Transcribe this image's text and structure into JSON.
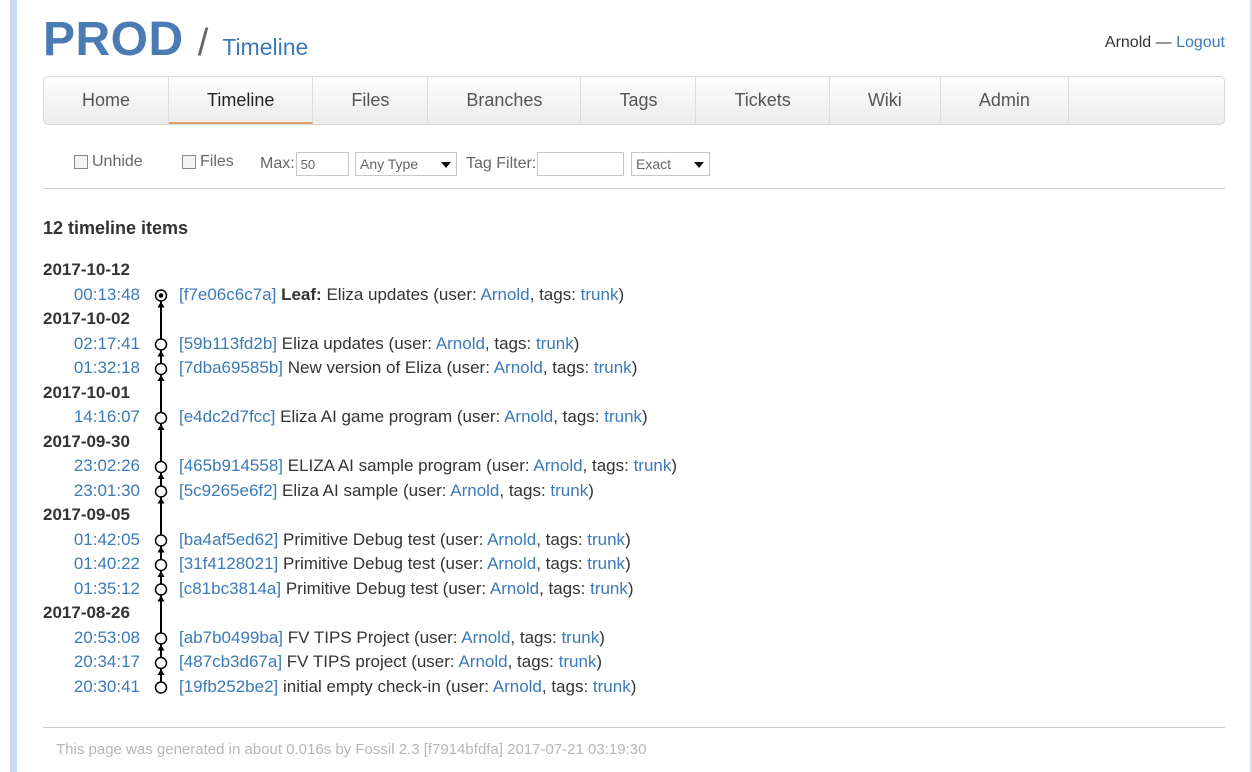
{
  "header": {
    "project": "PROD",
    "separator": "/",
    "page": "Timeline",
    "user": "Arnold",
    "dash": "—",
    "logout": "Logout"
  },
  "menu": {
    "items": [
      "Home",
      "Timeline",
      "Files",
      "Branches",
      "Tags",
      "Tickets",
      "Wiki",
      "Admin"
    ],
    "active": "Timeline"
  },
  "submenu": {
    "unhide_label": "Unhide",
    "files_label": "Files",
    "max_label": "Max:",
    "max_value": "50",
    "type_selected": "Any Type",
    "tag_filter_label": "Tag Filter:",
    "tag_filter_value": "",
    "match_selected": "Exact"
  },
  "timeline": {
    "count_text": "12 timeline items",
    "days": [
      {
        "date": "2017-10-12",
        "entries": [
          {
            "time": "00:13:48",
            "hash": "[f7e06c6c7a]",
            "prefix": "Leaf:",
            "comment": "Eliza updates",
            "user": "Arnold",
            "tag": "trunk",
            "leaf": true
          }
        ]
      },
      {
        "date": "2017-10-02",
        "entries": [
          {
            "time": "02:17:41",
            "hash": "[59b113fd2b]",
            "comment": "Eliza updates",
            "user": "Arnold",
            "tag": "trunk"
          },
          {
            "time": "01:32:18",
            "hash": "[7dba69585b]",
            "comment": "New version of Eliza",
            "user": "Arnold",
            "tag": "trunk"
          }
        ]
      },
      {
        "date": "2017-10-01",
        "entries": [
          {
            "time": "14:16:07",
            "hash": "[e4dc2d7fcc]",
            "comment": "Eliza AI game program",
            "user": "Arnold",
            "tag": "trunk"
          }
        ]
      },
      {
        "date": "2017-09-30",
        "entries": [
          {
            "time": "23:02:26",
            "hash": "[465b914558]",
            "comment": "ELIZA AI sample program",
            "user": "Arnold",
            "tag": "trunk"
          },
          {
            "time": "23:01:30",
            "hash": "[5c9265e6f2]",
            "comment": "Eliza AI sample",
            "user": "Arnold",
            "tag": "trunk"
          }
        ]
      },
      {
        "date": "2017-09-05",
        "entries": [
          {
            "time": "01:42:05",
            "hash": "[ba4af5ed62]",
            "comment": "Primitive Debug test",
            "user": "Arnold",
            "tag": "trunk"
          },
          {
            "time": "01:40:22",
            "hash": "[31f4128021]",
            "comment": "Primitive Debug test",
            "user": "Arnold",
            "tag": "trunk"
          },
          {
            "time": "01:35:12",
            "hash": "[c81bc3814a]",
            "comment": "Primitive Debug test",
            "user": "Arnold",
            "tag": "trunk"
          }
        ]
      },
      {
        "date": "2017-08-26",
        "entries": [
          {
            "time": "20:53:08",
            "hash": "[ab7b0499ba]",
            "comment": "FV TIPS Project",
            "user": "Arnold",
            "tag": "trunk"
          },
          {
            "time": "20:34:17",
            "hash": "[487cb3d67a]",
            "comment": "FV TIPS project",
            "user": "Arnold",
            "tag": "trunk"
          },
          {
            "time": "20:30:41",
            "hash": "[19fb252be2]",
            "comment": "initial empty check-in",
            "user": "Arnold",
            "tag": "trunk"
          }
        ]
      }
    ]
  },
  "footer": {
    "text": "This page was generated in about 0.016s by Fossil 2.3 [f7914bfdfa] 2017-07-21 03:19:30"
  },
  "colors": {
    "link": "#3a7ab8",
    "project": "#4b7bb4",
    "active_tab_underline": "#e0a067"
  }
}
